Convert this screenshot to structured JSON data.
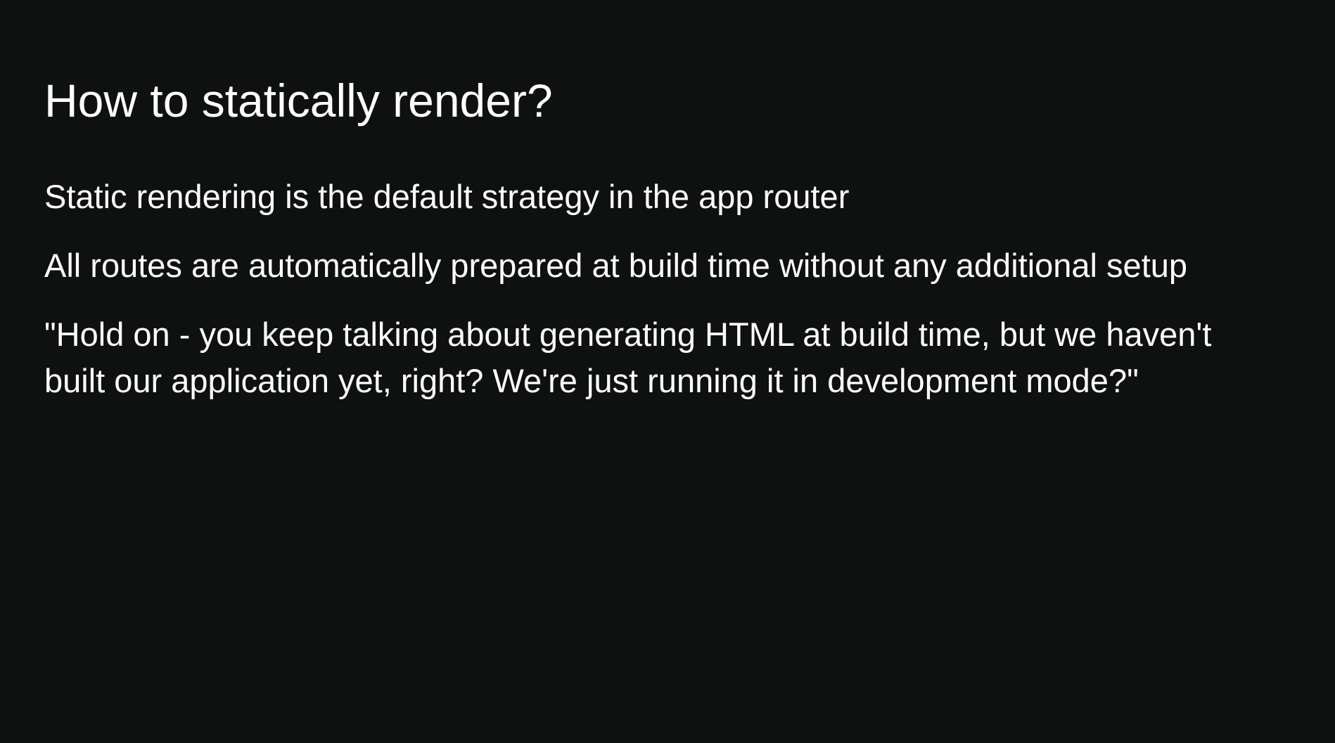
{
  "slide": {
    "title": "How to statically render?",
    "paragraphs": [
      "Static rendering is the default strategy in the app router",
      "All routes are automatically prepared at build time without any additional setup",
      "\"Hold on - you keep talking about generating HTML at build time, but we haven't built our application yet, right? We're just running it in development mode?\""
    ],
    "colors": {
      "background": "#0f1111",
      "text": "#ffffff"
    }
  }
}
